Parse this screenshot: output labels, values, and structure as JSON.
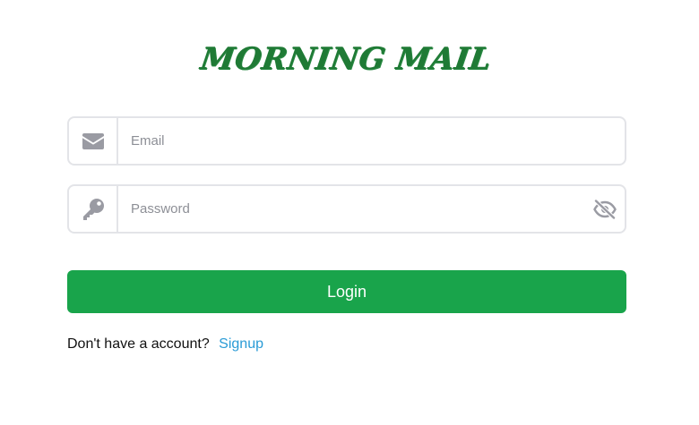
{
  "brand": {
    "title": "MORNING MAIL"
  },
  "email": {
    "placeholder": "Email",
    "value": "",
    "icon": "envelope-icon"
  },
  "password": {
    "placeholder": "Password",
    "value": "",
    "icon": "key-icon",
    "toggle_icon": "eye-slash-icon"
  },
  "login": {
    "label": "Login"
  },
  "signup": {
    "prompt": "Don't have a account?",
    "link_label": "Signup"
  },
  "colors": {
    "brand": "#1f7a35",
    "primary": "#19a44b",
    "link": "#2a9bd6",
    "icon": "#9a9ba3",
    "border": "#e3e4e8"
  }
}
